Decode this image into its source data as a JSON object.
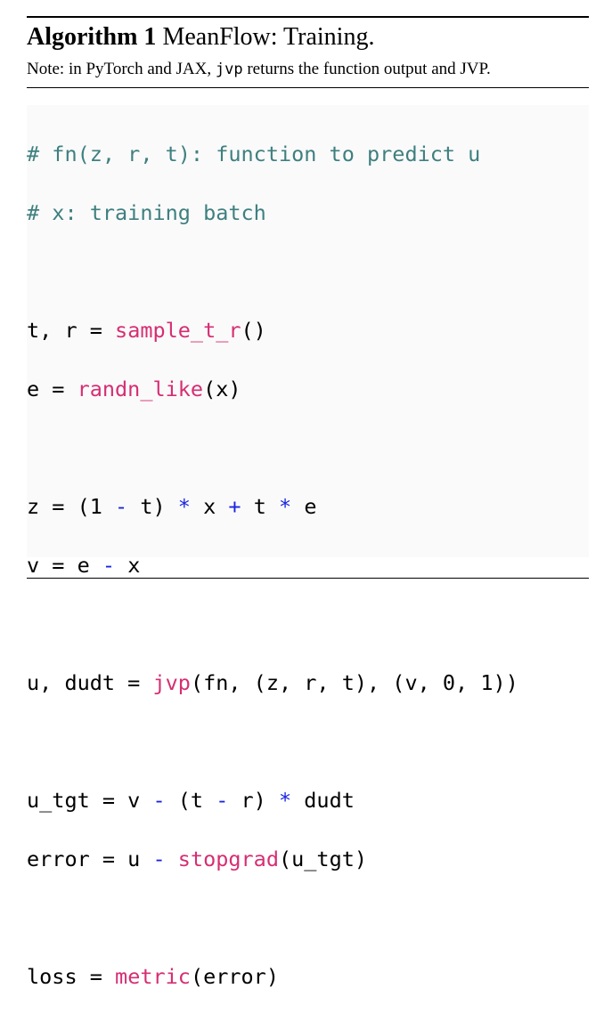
{
  "header": {
    "algorithm_label": "Algorithm 1",
    "title": "MeanFlow: Training."
  },
  "note": {
    "prefix": "Note: in PyTorch and JAX, ",
    "code_word": "jvp",
    "suffix": " returns the function output and JVP."
  },
  "code": {
    "comment_fn": "# fn(z, r, t): function to predict u",
    "comment_x": "# x: training batch",
    "l3_a": "t, r = ",
    "l3_fn": "sample_t_r",
    "l3_b": "()",
    "l4_a": "e = ",
    "l4_fn": "randn_like",
    "l4_b": "(x)",
    "l5_a": "z = (1 ",
    "l5_op1": "-",
    "l5_b": " t) ",
    "l5_op2": "*",
    "l5_c": " x ",
    "l5_op3": "+",
    "l5_d": " t ",
    "l5_op4": "*",
    "l5_e": " e",
    "l6_a": "v = e ",
    "l6_op": "-",
    "l6_b": " x",
    "l7_a": "u, dudt = ",
    "l7_fn": "jvp",
    "l7_b": "(fn, (z, r, t), (v, 0, 1))",
    "l8_a": "u_tgt = v ",
    "l8_op1": "-",
    "l8_b": " (t ",
    "l8_op2": "-",
    "l8_c": " r) ",
    "l8_op3": "*",
    "l8_d": " dudt",
    "l9_a": "error = u ",
    "l9_op": "-",
    "l9_b": " ",
    "l9_fn": "stopgrad",
    "l9_c": "(u_tgt)",
    "l10_a": "loss = ",
    "l10_fn": "metric",
    "l10_b": "(error)"
  },
  "colors": {
    "comment": "#3f7f7f",
    "function": "#d62e73",
    "operator": "#1a24e0",
    "code_background": "#fafafa"
  }
}
